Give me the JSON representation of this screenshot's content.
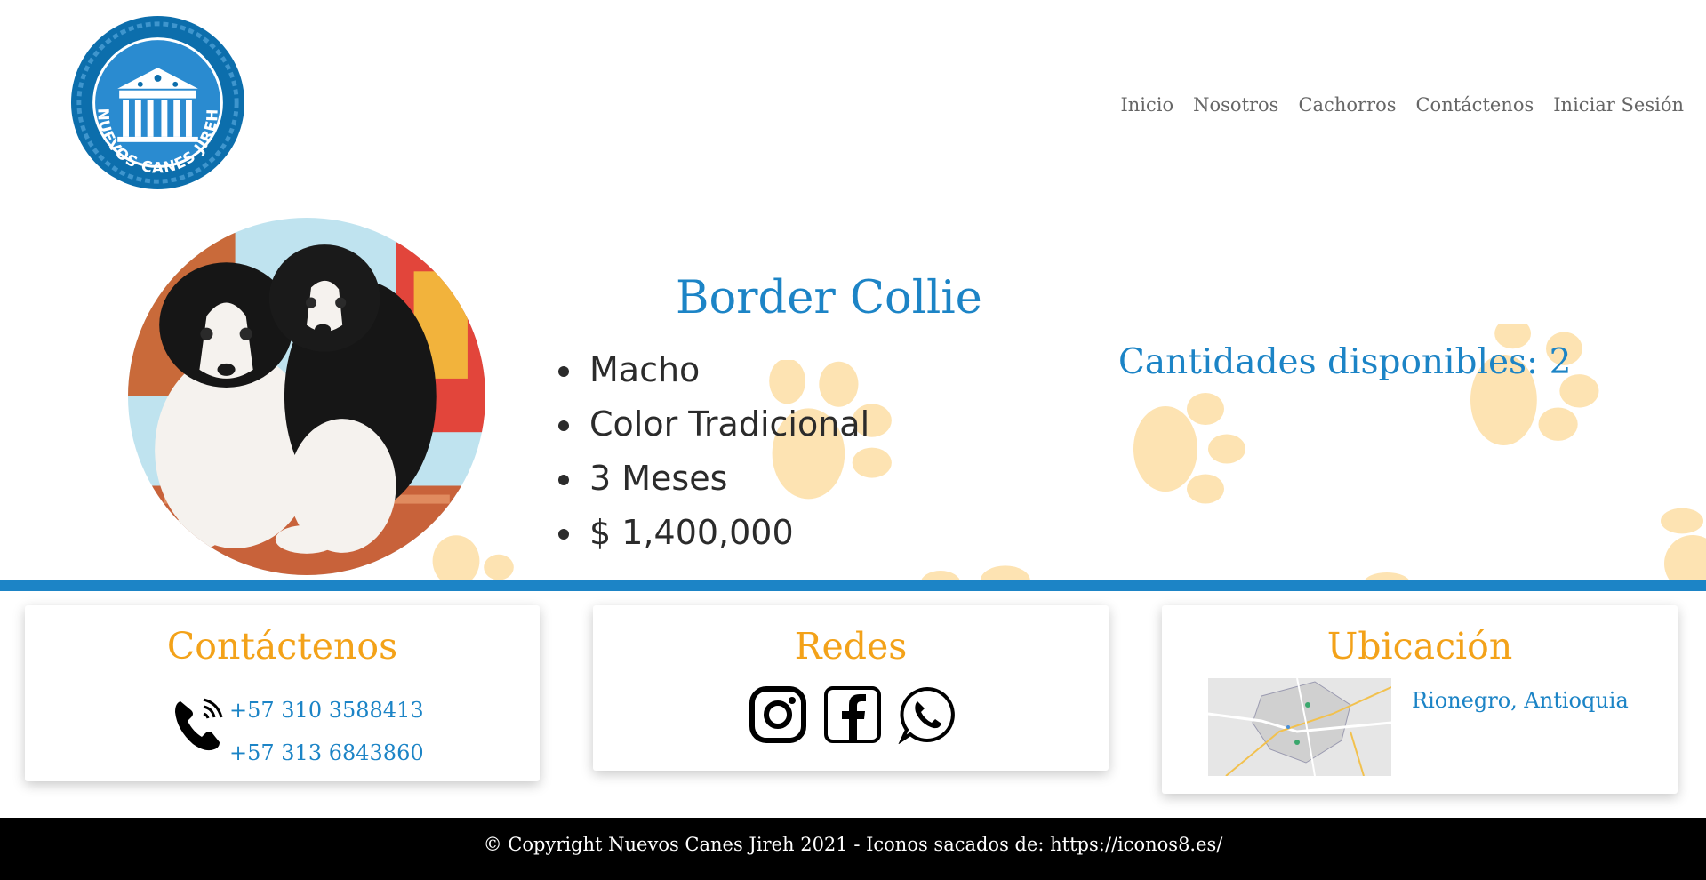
{
  "brand": {
    "logo_text": "NUEVOS CANES JIREH",
    "primary_color": "#1c84c6",
    "accent_color": "#f3a219",
    "paw_color": "#fde3b2"
  },
  "nav": {
    "items": [
      "Inicio",
      "Nosotros",
      "Cachorros",
      "Contáctenos",
      "Iniciar Sesión"
    ]
  },
  "puppy": {
    "image": "border-collie-puppies-photo",
    "breed": "Border Collie",
    "details": [
      "Macho",
      "Color Tradicional",
      "3 Meses",
      "$ 1,400,000"
    ],
    "availability": "Cantidades disponibles: 2"
  },
  "contact": {
    "title": "Contáctenos",
    "icon": "phone-icon",
    "phones": [
      "+57 310 3588413",
      "+57 313 6843860"
    ]
  },
  "social": {
    "title": "Redes",
    "icons": [
      "instagram-icon",
      "facebook-icon",
      "whatsapp-icon"
    ]
  },
  "location": {
    "title": "Ubicación",
    "map": "map-thumbnail",
    "place": "Rionegro, Antioquia"
  },
  "footer": {
    "text": "© Copyright Nuevos Canes Jireh 2021 - Iconos sacados de: https://iconos8.es/"
  }
}
